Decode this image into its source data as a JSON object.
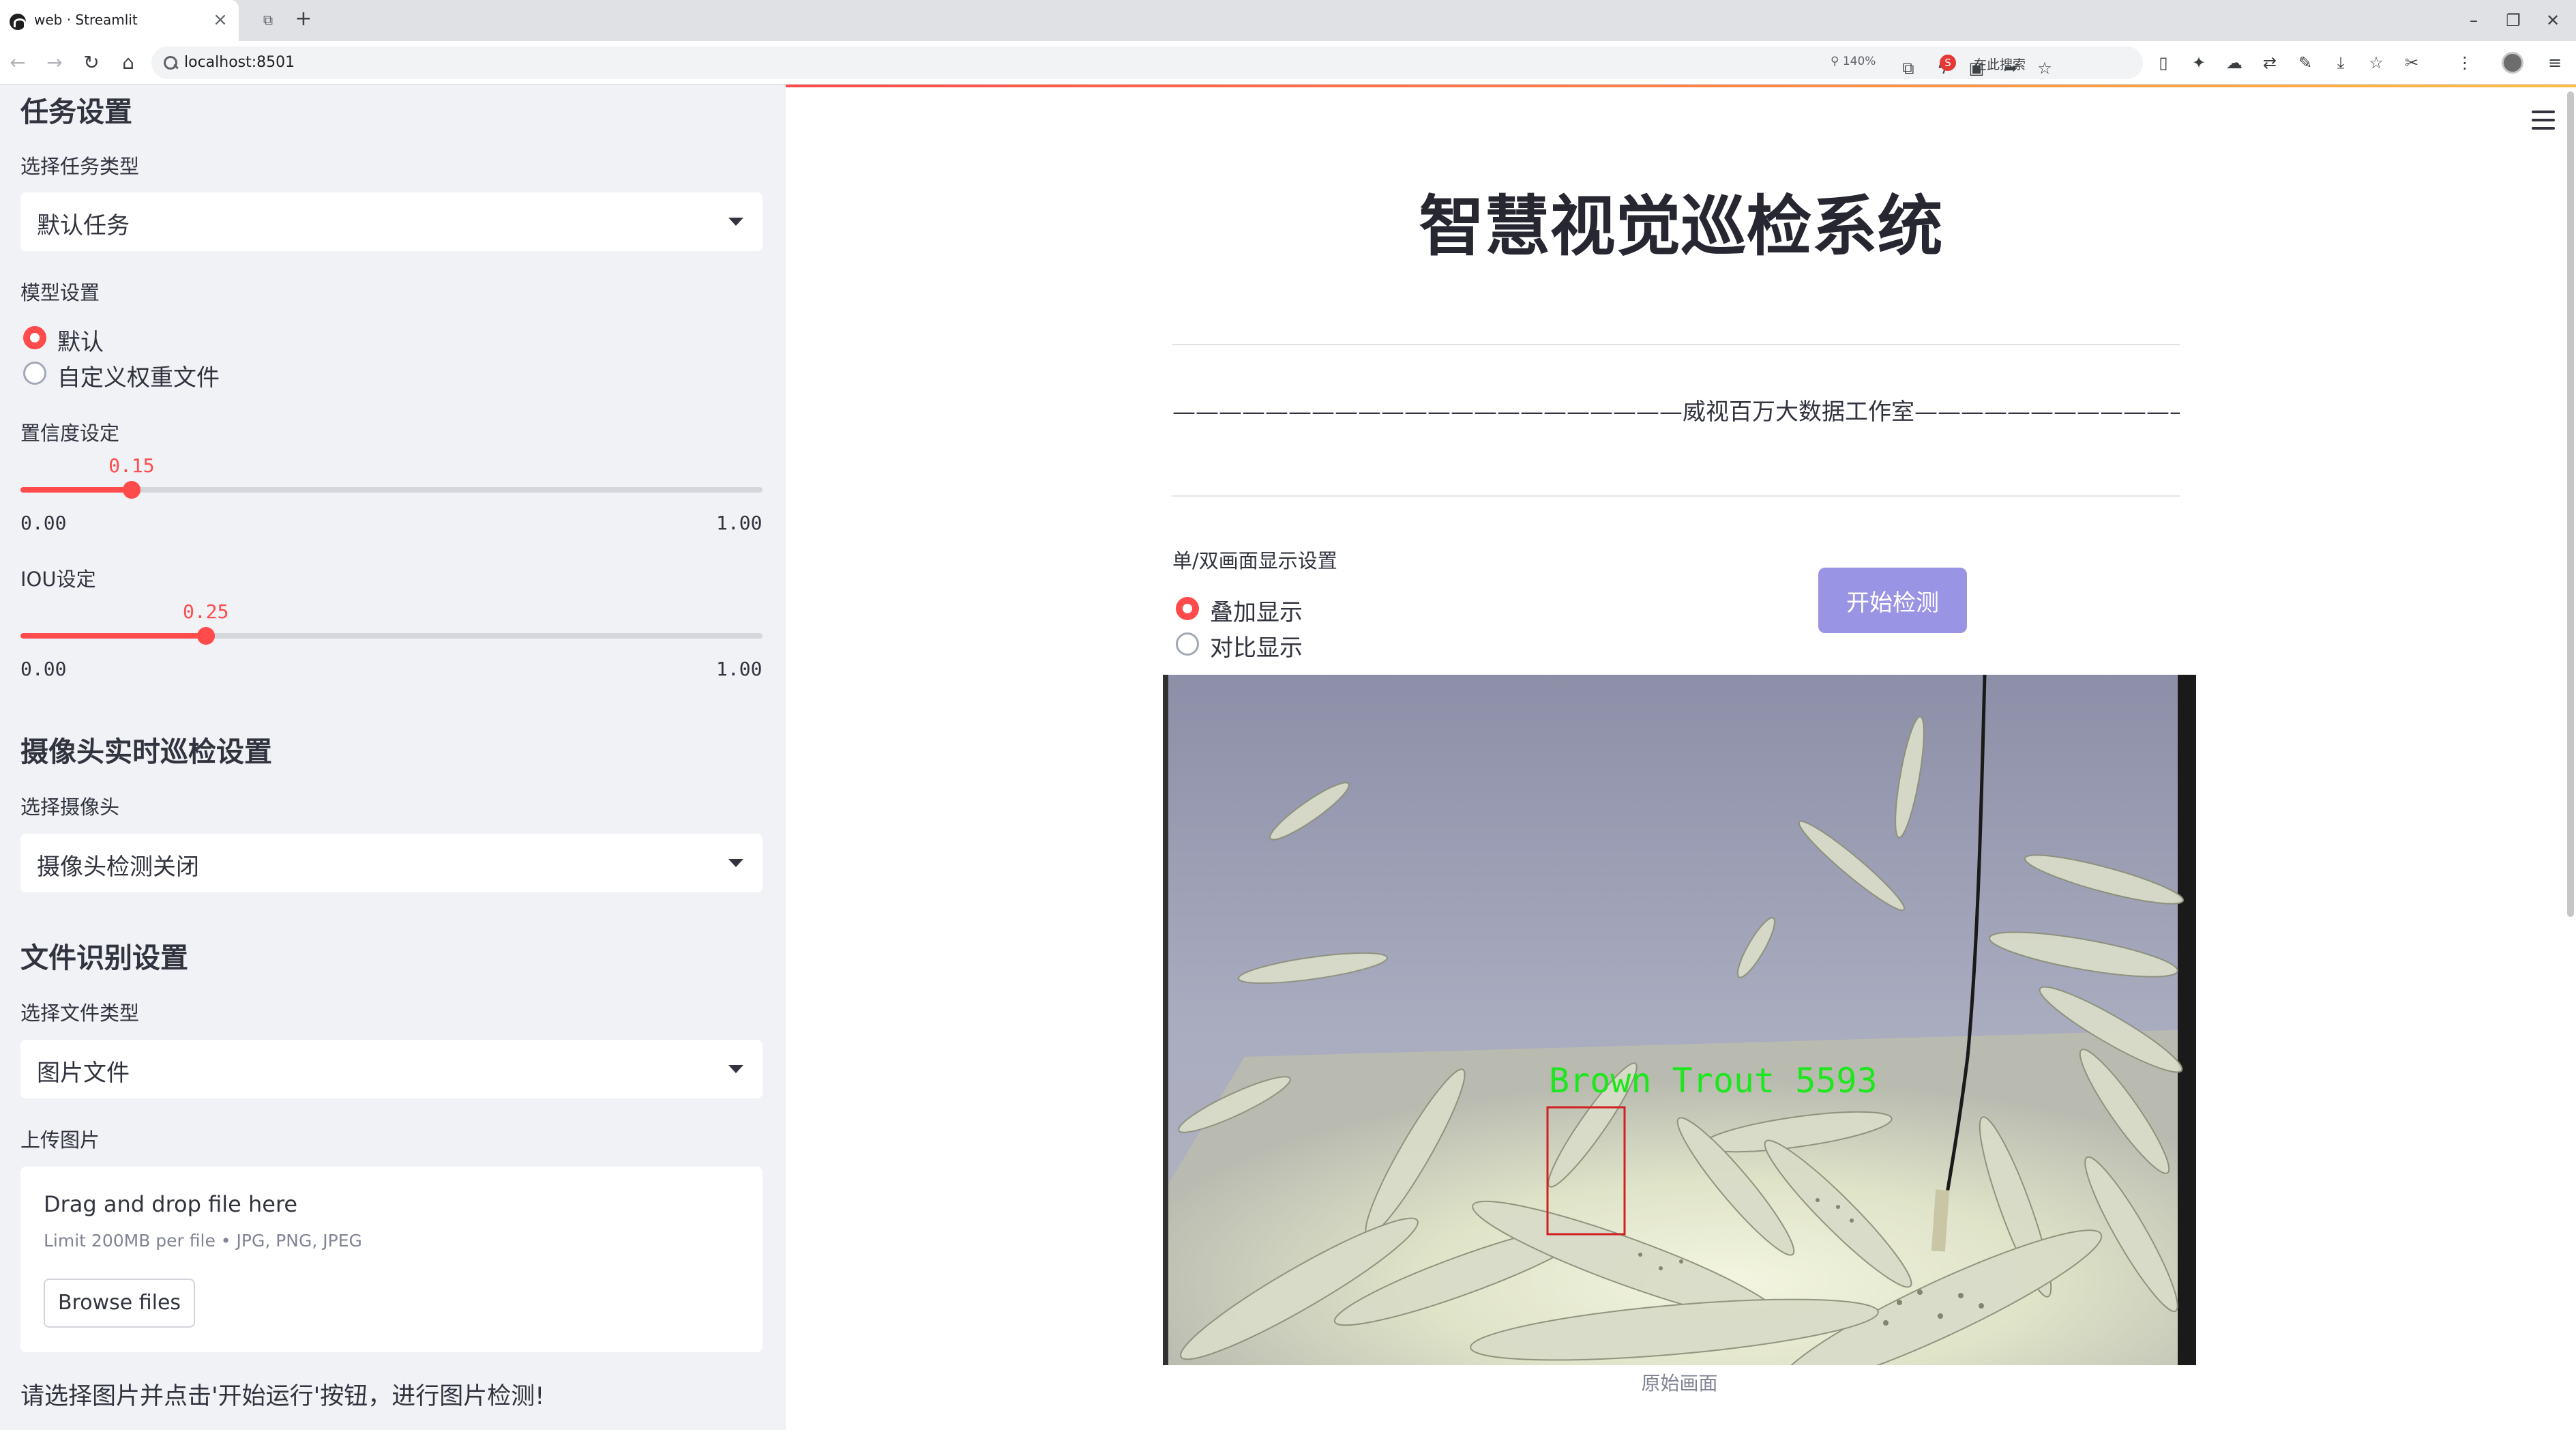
{
  "browser": {
    "tab_title": "web · Streamlit",
    "url": "localhost:8501",
    "zoom": "140%",
    "search_engine_label": "在此搜索"
  },
  "sidebar": {
    "task_section_title": "任务设置",
    "task_type_label": "选择任务类型",
    "task_type_value": "默认任务",
    "model_label": "模型设置",
    "model_options": [
      "默认",
      "自定义权重文件"
    ],
    "model_selected": "默认",
    "confidence": {
      "label": "置信度设定",
      "value": "0.15",
      "min": "0.00",
      "max": "1.00",
      "fraction": 0.15
    },
    "iou": {
      "label": "IOU设定",
      "value": "0.25",
      "min": "0.00",
      "max": "1.00",
      "fraction": 0.25
    },
    "camera_section_title": "摄像头实时巡检设置",
    "camera_label": "选择摄像头",
    "camera_value": "摄像头检测关闭",
    "file_section_title": "文件识别设置",
    "file_type_label": "选择文件类型",
    "file_type_value": "图片文件",
    "upload_label": "上传图片",
    "uploader": {
      "title": "Drag and drop file here",
      "limit": "Limit 200MB per file • JPG, PNG, JPEG",
      "browse_button": "Browse files"
    },
    "hint": "请选择图片并点击'开始运行'按钮，进行图片检测!"
  },
  "main": {
    "title": "智慧视觉巡检系统",
    "studio_line": "——————————————————————威视百万大数据工作室———————————————————————",
    "display_label": "单/双画面显示设置",
    "display_options": [
      "叠加显示",
      "对比显示"
    ],
    "display_selected": "叠加显示",
    "start_button": "开始检测",
    "detection_label": "Brown Trout 5593",
    "image_caption": "原始画面"
  },
  "colors": {
    "accent": "#ff4b4b",
    "sidebar_bg": "#f0f2f6",
    "button_disabled": "#9a94e4",
    "detection_text": "#1ee61e",
    "detection_box": "#d02020"
  }
}
